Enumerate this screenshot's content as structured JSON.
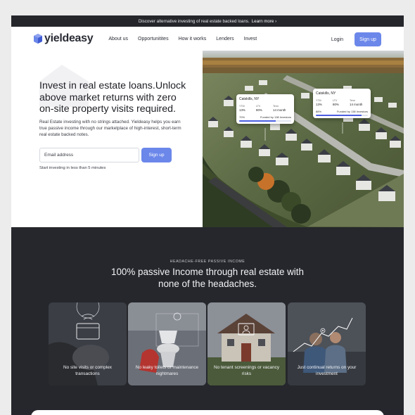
{
  "announcement": {
    "text": "Discover alternative investing of real estate backed loans.",
    "link": "Learn more ›"
  },
  "brand": {
    "name": "yieldeasy"
  },
  "nav": {
    "items": [
      "About us",
      "Opportunitites",
      "How it works",
      "Lenders",
      "Invest"
    ],
    "login": "Login",
    "signup": "Sign up"
  },
  "hero": {
    "title": "Invest in real estate loans.Unlock above market returns with zero on-site property visits required.",
    "description": "Real Estate investing with no strings attached. Yieldeasy helps you earn true passive income through our marketplace of high-interest, short-term real estate backed notes.",
    "email_placeholder": "Email address",
    "signup": "Sign up",
    "note": "Start investing in less than 5 minutes"
  },
  "loan_cards": [
    {
      "city": "Catskills, NY",
      "headers": [
        "YTM",
        "LTV",
        "Term"
      ],
      "values": [
        "13%",
        "80%",
        "14 month"
      ],
      "funded_pct": "70%",
      "funded_text": "Funded by 138 Investors",
      "progress": 0.7
    },
    {
      "city": "Catskills, NY",
      "headers": [
        "YTM",
        "LTV",
        "Term"
      ],
      "values": [
        "13%",
        "80%",
        "14 month"
      ],
      "funded_pct": "88%",
      "funded_text": "Funded by 138 Investors",
      "progress": 0.88
    }
  ],
  "section": {
    "eyebrow": "HEADACHE-FREE PASSIVE INCOME",
    "title": "100% passive Income through real estate with none of the headaches."
  },
  "features": [
    {
      "caption": "No site visits or complex transactions",
      "icon": "card-payment-icon"
    },
    {
      "caption": "No leaky toilets or maintenance nightmares",
      "icon": "toilet-icon"
    },
    {
      "caption": "No tenant screenings or vacancy risks",
      "icon": "tenant-screen-icon"
    },
    {
      "caption": "Just continual returns on your investment",
      "icon": "growth-chart-icon"
    }
  ],
  "colors": {
    "accent": "#6b87ea",
    "dark_bg": "#25272c",
    "progress": "#4a5ee0"
  }
}
